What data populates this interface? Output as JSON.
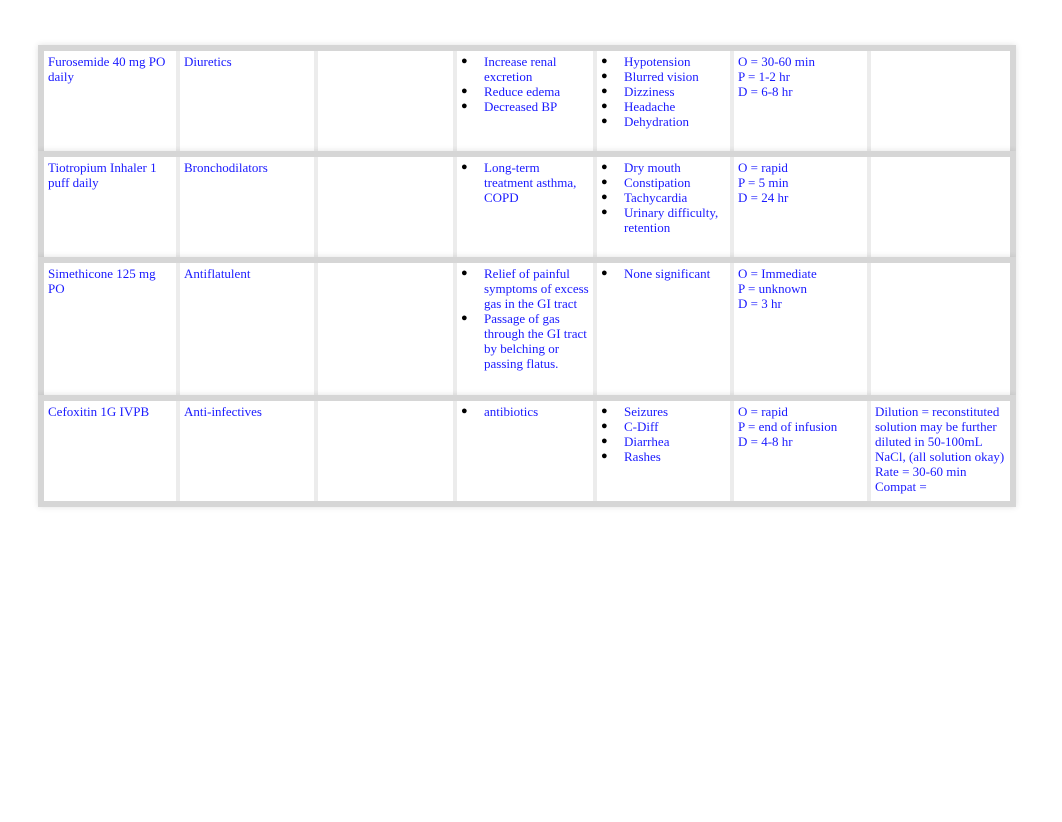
{
  "rows": [
    {
      "medication": "Furosemide 40 mg PO daily",
      "classification": "Diuretics",
      "action": "",
      "indications": [
        "Increase renal excretion",
        "Reduce edema",
        "Decreased BP"
      ],
      "side_effects": [
        "Hypotension",
        "Blurred vision",
        "Dizziness",
        "Headache",
        "Dehydration"
      ],
      "opd": [
        "O = 30-60 min",
        "P = 1-2 hr",
        "D = 6-8 hr"
      ],
      "notes": []
    },
    {
      "medication": "Tiotropium Inhaler  1 puff daily",
      "classification": "Bronchodilators",
      "action": "",
      "indications": [
        "Long-term treatment asthma, COPD"
      ],
      "side_effects": [
        "Dry mouth",
        "Constipation",
        "Tachycardia",
        "Urinary difficulty, retention"
      ],
      "opd": [
        "O = rapid",
        "P = 5 min",
        "D = 24 hr"
      ],
      "notes": []
    },
    {
      "medication": "Simethicone 125 mg PO",
      "classification": "Antiflatulent",
      "action": "",
      "indications": [
        "Relief of painful symptoms  of excess  gas  in the GI tract",
        "Passage  of gas through the GI tract by belching or passing flatus."
      ],
      "side_effects": [
        "None  significant"
      ],
      "opd": [
        "O = Immediate",
        "P = unknown",
        "D = 3 hr"
      ],
      "notes": []
    },
    {
      "medication": "Cefoxitin 1G IVPB",
      "classification": "Anti-infectives",
      "action": "",
      "indications": [
        "antibiotics"
      ],
      "side_effects": [
        "Seizures",
        "C-Diff",
        "Diarrhea",
        "Rashes"
      ],
      "opd": [
        "O = rapid",
        "P = end of infusion",
        "D = 4-8 hr"
      ],
      "notes": [
        "Dilution = reconstituted solution may be  further diluted in 50-100mL NaCl, (all solution okay)",
        "Rate = 30-60  min",
        "Compat ="
      ]
    }
  ],
  "bullet_glyph": "●",
  "text_color": "#1a1aff"
}
